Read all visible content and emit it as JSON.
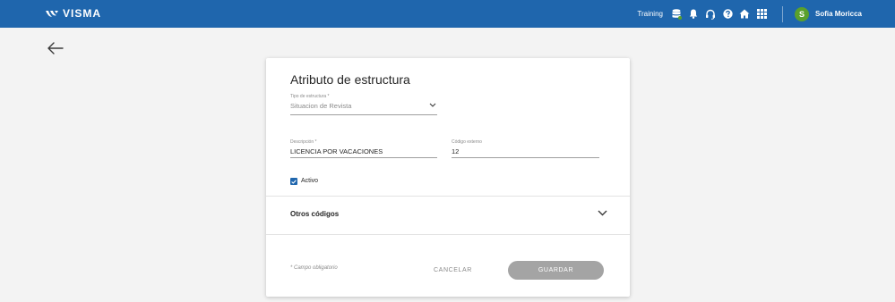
{
  "header": {
    "brand": "VISMA",
    "environment": "Training",
    "icons": [
      "database-icon",
      "bell-icon",
      "headset-icon",
      "help-icon",
      "home-icon",
      "apps-grid-icon"
    ],
    "user": {
      "initial": "S",
      "name": "Sofia Moricca",
      "avatar_color": "#5aa02c"
    },
    "bar_color": "#1f66ad"
  },
  "page": {
    "back_icon": "arrow-left-icon"
  },
  "form": {
    "title": "Atributo de estructura",
    "tipo_estructura": {
      "label": "Tipo de estructura *",
      "value": "Situacion de Revista"
    },
    "descripcion": {
      "label": "Descripción *",
      "value": "LICENCIA POR VACACIONES"
    },
    "codigo_externo": {
      "label": "Código externo",
      "value": "12"
    },
    "activo": {
      "label": "Activo",
      "checked": true
    },
    "otros_codigos": {
      "label": "Otros códigos",
      "expanded": false
    },
    "required_note": "* Campo obligatorio",
    "cancel_label": "CANCELAR",
    "save_label": "GUARDAR"
  }
}
